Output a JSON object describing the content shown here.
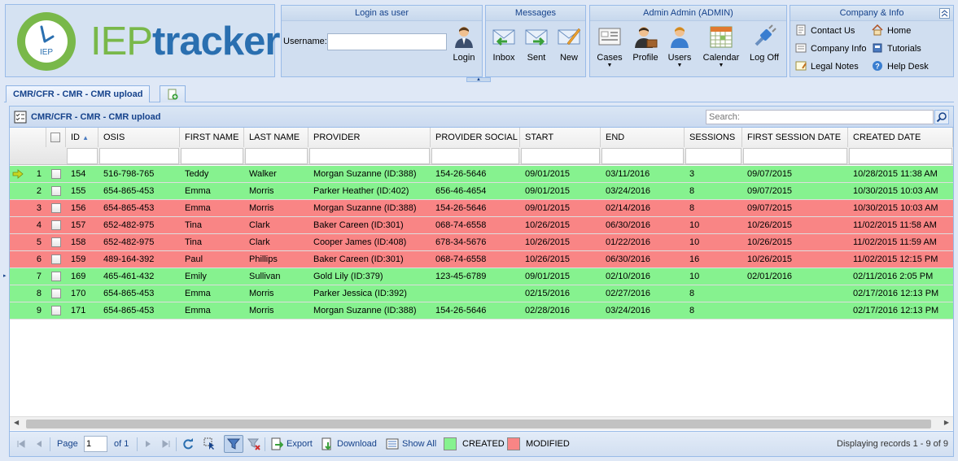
{
  "brand": {
    "iep": "IEP",
    "tracker": "tracker",
    "circle_text": "IEP",
    "green": "#79b84a",
    "blue": "#2a6fb0"
  },
  "login_panel": {
    "title": "Login as user",
    "username_label": "Username:",
    "username_value": "",
    "login_label": "Login"
  },
  "messages_panel": {
    "title": "Messages",
    "inbox": "Inbox",
    "sent": "Sent",
    "new": "New"
  },
  "admin_panel": {
    "title": "Admin Admin (ADMIN)",
    "cases": "Cases",
    "profile": "Profile",
    "users": "Users",
    "calendar": "Calendar",
    "logoff": "Log Off"
  },
  "company_panel": {
    "title": "Company & Info",
    "contact_us": "Contact Us",
    "home": "Home",
    "company_info": "Company Info",
    "tutorials": "Tutorials",
    "legal_notes": "Legal Notes",
    "help_desk": "Help Desk"
  },
  "tabs": {
    "active": "CMR/CFR - CMR - CMR upload"
  },
  "panel": {
    "title": "CMR/CFR - CMR - CMR upload",
    "search_placeholder": "Search:"
  },
  "columns": [
    "ID",
    "OSIS",
    "FIRST NAME",
    "LAST NAME",
    "PROVIDER",
    "PROVIDER SOCIAL",
    "START",
    "END",
    "SESSIONS",
    "FIRST SESSION DATE",
    "CREATED DATE"
  ],
  "sort": {
    "column": "ID",
    "direction": "asc"
  },
  "colors": {
    "created": "#86f28f",
    "modified": "#f98585"
  },
  "rows": [
    {
      "n": "1",
      "id": "154",
      "osis": "516-798-765",
      "first": "Teddy",
      "last": "Walker",
      "provider": "Morgan Suzanne (ID:388)",
      "social": "154-26-5646",
      "start": "09/01/2015",
      "end": "03/11/2016",
      "sessions": "3",
      "first_session": "09/07/2015",
      "created": "10/28/2015 11:38 AM",
      "status": "created",
      "current": true
    },
    {
      "n": "2",
      "id": "155",
      "osis": "654-865-453",
      "first": "Emma",
      "last": "Morris",
      "provider": "Parker Heather (ID:402)",
      "social": "656-46-4654",
      "start": "09/01/2015",
      "end": "03/24/2016",
      "sessions": "8",
      "first_session": "09/07/2015",
      "created": "10/30/2015 10:03 AM",
      "status": "created"
    },
    {
      "n": "3",
      "id": "156",
      "osis": "654-865-453",
      "first": "Emma",
      "last": "Morris",
      "provider": "Morgan Suzanne (ID:388)",
      "social": "154-26-5646",
      "start": "09/01/2015",
      "end": "02/14/2016",
      "sessions": "8",
      "first_session": "09/07/2015",
      "created": "10/30/2015 10:03 AM",
      "status": "modified"
    },
    {
      "n": "4",
      "id": "157",
      "osis": "652-482-975",
      "first": "Tina",
      "last": "Clark",
      "provider": "Baker Careen (ID:301)",
      "social": "068-74-6558",
      "start": "10/26/2015",
      "end": "06/30/2016",
      "sessions": "10",
      "first_session": "10/26/2015",
      "created": "11/02/2015 11:58 AM",
      "status": "modified"
    },
    {
      "n": "5",
      "id": "158",
      "osis": "652-482-975",
      "first": "Tina",
      "last": "Clark",
      "provider": "Cooper James (ID:408)",
      "social": "678-34-5676",
      "start": "10/26/2015",
      "end": "01/22/2016",
      "sessions": "10",
      "first_session": "10/26/2015",
      "created": "11/02/2015 11:59 AM",
      "status": "modified"
    },
    {
      "n": "6",
      "id": "159",
      "osis": "489-164-392",
      "first": "Paul",
      "last": "Phillips",
      "provider": "Baker Careen (ID:301)",
      "social": "068-74-6558",
      "start": "10/26/2015",
      "end": "06/30/2016",
      "sessions": "16",
      "first_session": "10/26/2015",
      "created": "11/02/2015 12:15 PM",
      "status": "modified"
    },
    {
      "n": "7",
      "id": "169",
      "osis": "465-461-432",
      "first": "Emily",
      "last": "Sullivan",
      "provider": "Gold Lily (ID:379)",
      "social": "123-45-6789",
      "start": "09/01/2015",
      "end": "02/10/2016",
      "sessions": "10",
      "first_session": "02/01/2016",
      "created": "02/11/2016 2:05 PM",
      "status": "created"
    },
    {
      "n": "8",
      "id": "170",
      "osis": "654-865-453",
      "first": "Emma",
      "last": "Morris",
      "provider": "Parker Jessica (ID:392)",
      "social": "",
      "start": "02/15/2016",
      "end": "02/27/2016",
      "sessions": "8",
      "first_session": "",
      "created": "02/17/2016 12:13 PM",
      "status": "created"
    },
    {
      "n": "9",
      "id": "171",
      "osis": "654-865-453",
      "first": "Emma",
      "last": "Morris",
      "provider": "Morgan Suzanne (ID:388)",
      "social": "154-26-5646",
      "start": "02/28/2016",
      "end": "03/24/2016",
      "sessions": "8",
      "first_session": "",
      "created": "02/17/2016 12:13 PM",
      "status": "created"
    }
  ],
  "pager": {
    "page_label": "Page",
    "page_value": "1",
    "of_label": "of 1",
    "export": "Export",
    "download": "Download",
    "show_all": "Show All",
    "created_label": "CREATED",
    "modified_label": "MODIFIED",
    "display_info": "Displaying records 1 - 9 of 9"
  }
}
